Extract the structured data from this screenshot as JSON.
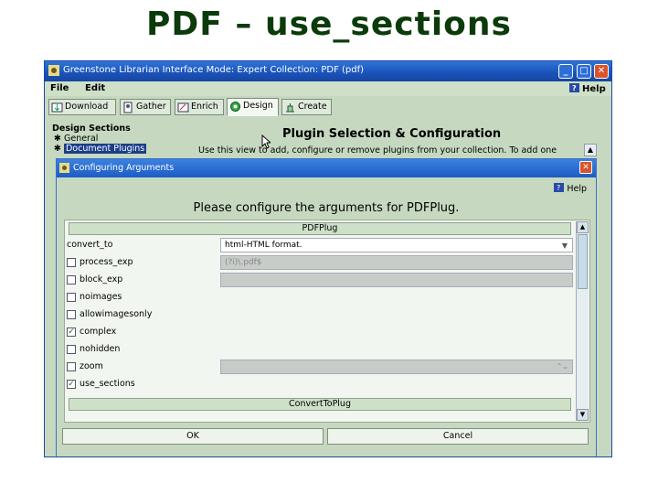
{
  "slide": {
    "title": "PDF – use_sections"
  },
  "window": {
    "title": "Greenstone Librarian Interface  Mode: Expert  Collection: PDF (pdf)",
    "controls": {
      "minimize": "_",
      "maximize": "□",
      "close": "✕"
    }
  },
  "menubar": {
    "file": "File",
    "edit": "Edit",
    "help": "Help"
  },
  "tabs": [
    {
      "label": "Download",
      "icon": "download-icon"
    },
    {
      "label": "Gather",
      "icon": "gather-icon"
    },
    {
      "label": "Enrich",
      "icon": "enrich-icon"
    },
    {
      "label": "Design",
      "icon": "design-icon",
      "active": true
    },
    {
      "label": "Create",
      "icon": "create-icon"
    }
  ],
  "design_sections": {
    "heading": "Design Sections",
    "items": [
      "General",
      "Document Plugins"
    ],
    "selected": "Document Plugins"
  },
  "plugin_panel": {
    "heading": "Plugin Selection & Configuration",
    "description": "Use this view to add, configure or remove plugins from your collection. To add one"
  },
  "dialog": {
    "title": "Configuring Arguments",
    "help": "Help",
    "heading": "Please configure the arguments for PDFPlug.",
    "plugin_name": "PDFPlug",
    "next_plugin": "ConvertToPlug",
    "args": [
      {
        "name": "convert_to",
        "checkbox": false,
        "value": "html-HTML format.",
        "type": "combo"
      },
      {
        "name": "process_exp",
        "checkbox": true,
        "checked": false,
        "value": "(?i)\\.pdf$",
        "type": "text"
      },
      {
        "name": "block_exp",
        "checkbox": true,
        "checked": false,
        "value": "",
        "type": "text"
      },
      {
        "name": "noimages",
        "checkbox": true,
        "checked": false
      },
      {
        "name": "allowimagesonly",
        "checkbox": true,
        "checked": false
      },
      {
        "name": "complex",
        "checkbox": true,
        "checked": true
      },
      {
        "name": "nohidden",
        "checkbox": true,
        "checked": false
      },
      {
        "name": "zoom",
        "checkbox": true,
        "checked": false,
        "value": "",
        "type": "spinner"
      },
      {
        "name": "use_sections",
        "checkbox": true,
        "checked": true
      }
    ],
    "ok": "OK",
    "cancel": "Cancel"
  },
  "colors": {
    "titlebar": "#1a52b8",
    "panel": "#c6d9c0",
    "selection": "#1c3e8a",
    "slide_title": "#0b3b0b"
  }
}
